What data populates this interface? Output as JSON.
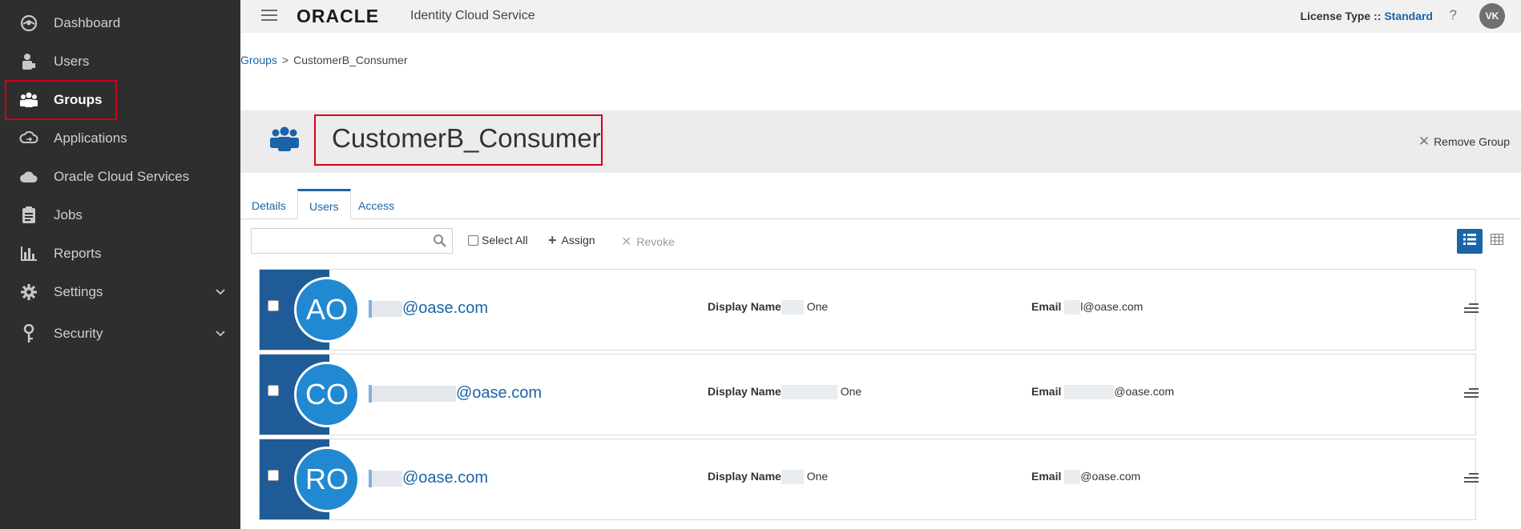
{
  "sidebar": {
    "items": [
      {
        "label": "Dashboard",
        "icon": "dashboard-icon",
        "active": false
      },
      {
        "label": "Users",
        "icon": "user-icon",
        "active": false
      },
      {
        "label": "Groups",
        "icon": "groups-icon",
        "active": true
      },
      {
        "label": "Applications",
        "icon": "applications-icon",
        "active": false
      },
      {
        "label": "Oracle Cloud Services",
        "icon": "cloud-icon",
        "active": false
      },
      {
        "label": "Jobs",
        "icon": "jobs-icon",
        "active": false
      },
      {
        "label": "Reports",
        "icon": "reports-icon",
        "active": false
      },
      {
        "label": "Settings",
        "icon": "gear-icon",
        "active": false,
        "expandable": true
      },
      {
        "label": "Security",
        "icon": "key-icon",
        "active": false,
        "expandable": true
      }
    ]
  },
  "header": {
    "logo_text": "ORACLE",
    "product_name": "Identity Cloud Service",
    "license_label": "License Type ::",
    "license_value": "Standard",
    "help_label": "?",
    "user_initials": "VK"
  },
  "breadcrumb": {
    "parent": "Groups",
    "separator": ">",
    "current": "CustomerB_Consumer"
  },
  "group": {
    "title": "CustomerB_Consumer",
    "remove_label": "Remove Group"
  },
  "tabs": [
    {
      "label": "Details",
      "active": false
    },
    {
      "label": "Users",
      "active": true
    },
    {
      "label": "Access",
      "active": false
    }
  ],
  "toolbar": {
    "search_value": "",
    "search_placeholder": "",
    "select_all_label": "Select All",
    "assign_label": "Assign",
    "revoke_label": "Revoke"
  },
  "users": [
    {
      "initials": "AO",
      "username_suffix": "@oase.com",
      "display_name_label": "Display Name",
      "display_name_suffix": "One",
      "email_label": "Email",
      "email_suffix": "l@oase.com"
    },
    {
      "initials": "CO",
      "username_suffix": "@oase.com",
      "display_name_label": "Display Name",
      "display_name_suffix": "One",
      "email_label": "Email",
      "email_suffix": "@oase.com"
    },
    {
      "initials": "RO",
      "username_suffix": "@oase.com",
      "display_name_label": "Display Name",
      "display_name_suffix": "One",
      "email_label": "Email",
      "email_suffix": "@oase.com"
    }
  ],
  "colors": {
    "sidebar_bg": "#2e2e2e",
    "accent_blue": "#1b64a8",
    "avatar_blue": "#2189d1",
    "card_stripe": "#1f5b97",
    "highlight_red": "#d0021b"
  }
}
